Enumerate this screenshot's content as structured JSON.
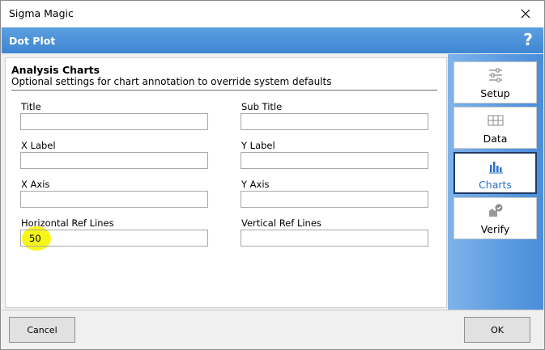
{
  "window": {
    "title": "Sigma Magic"
  },
  "header": {
    "title": "Dot Plot",
    "help_glyph": "?"
  },
  "section": {
    "title": "Analysis Charts",
    "subtitle": "Optional settings for chart annotation to override system defaults"
  },
  "fields": {
    "title": {
      "label": "Title",
      "value": ""
    },
    "subtitle": {
      "label": "Sub Title",
      "value": ""
    },
    "xlabel": {
      "label": "X Label",
      "value": ""
    },
    "ylabel": {
      "label": "Y Label",
      "value": ""
    },
    "xaxis": {
      "label": "X Axis",
      "value": ""
    },
    "yaxis": {
      "label": "Y Axis",
      "value": ""
    },
    "href": {
      "label": "Horizontal Ref Lines",
      "value": "50"
    },
    "vref": {
      "label": "Vertical Ref Lines",
      "value": ""
    }
  },
  "sidebar": {
    "items": [
      {
        "label": "Setup",
        "icon": "sliders-icon"
      },
      {
        "label": "Data",
        "icon": "grid-icon"
      },
      {
        "label": "Charts",
        "icon": "bar-chart-icon",
        "active": true
      },
      {
        "label": "Verify",
        "icon": "verify-icon"
      }
    ]
  },
  "footer": {
    "cancel_label": "Cancel",
    "ok_label": "OK"
  },
  "colors": {
    "header": "#4a90d9",
    "highlight": "#f5f500",
    "active_label": "#2a6fc9"
  }
}
